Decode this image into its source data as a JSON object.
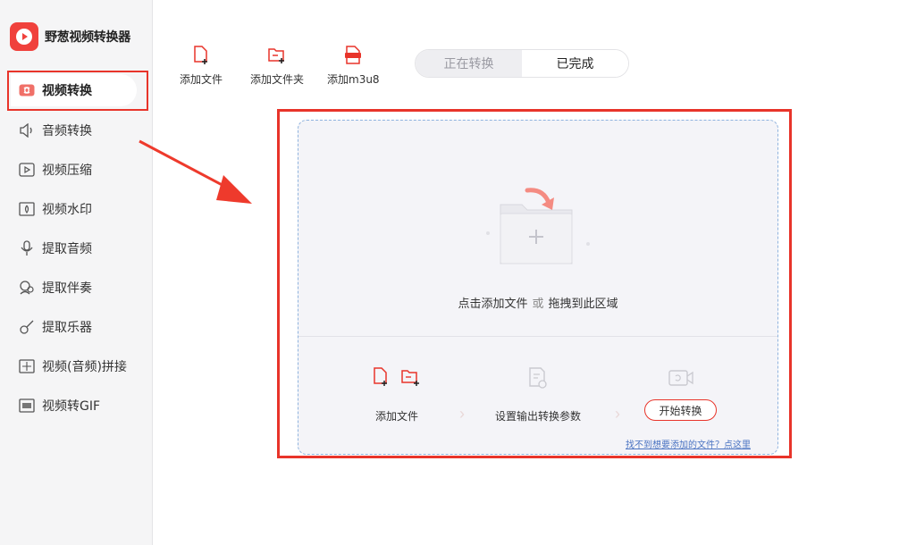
{
  "app": {
    "title": "野葱视频转换器",
    "logo_icon": "play-logo-icon",
    "brand_color": "#f0413c"
  },
  "sidebar": {
    "items": [
      {
        "label": "视频转换",
        "icon": "video-convert-icon",
        "active": true
      },
      {
        "label": "音频转换",
        "icon": "speaker-icon"
      },
      {
        "label": "视频压缩",
        "icon": "video-compress-icon"
      },
      {
        "label": "视频水印",
        "icon": "watermark-icon"
      },
      {
        "label": "提取音频",
        "icon": "microphone-icon"
      },
      {
        "label": "提取伴奏",
        "icon": "accompaniment-icon"
      },
      {
        "label": "提取乐器",
        "icon": "guitar-icon"
      },
      {
        "label": "视频(音频)拼接",
        "icon": "merge-icon"
      },
      {
        "label": "视频转GIF",
        "icon": "gif-icon"
      }
    ]
  },
  "toolbar": {
    "add_file": "添加文件",
    "add_folder": "添加文件夹",
    "add_m3u8": "添加m3u8"
  },
  "tabs": {
    "converting": "正在转换",
    "completed": "已完成"
  },
  "dropzone": {
    "text_click": "点击添加文件",
    "text_or": "或",
    "text_drag": "拖拽到此区域"
  },
  "steps": {
    "add_file": "添加文件",
    "set_params": "设置输出转换参数",
    "start": "开始转换"
  },
  "help_link": "找不到想要添加的文件？点这里",
  "colors": {
    "accent": "#e8342a",
    "link": "#4a73c2"
  }
}
